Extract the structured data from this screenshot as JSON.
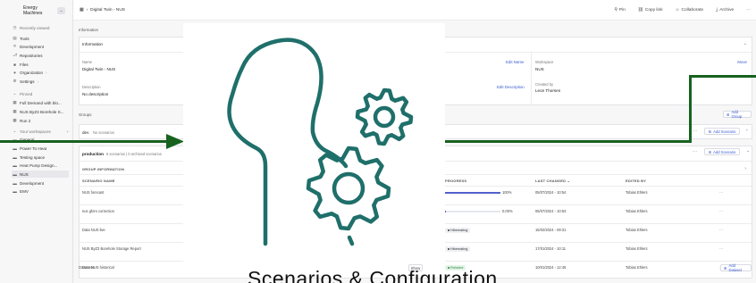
{
  "org": {
    "name": "Energy Machines",
    "switch_icon": "chevron-updown-icon"
  },
  "sidebar": {
    "recent": "Recently viewed",
    "nav": [
      {
        "label": "Tools",
        "icon": "tools-icon"
      },
      {
        "label": "Development",
        "icon": "development-icon"
      },
      {
        "label": "Repositories",
        "icon": "repositories-icon"
      },
      {
        "label": "Files",
        "icon": "files-icon"
      },
      {
        "label": "Organization",
        "icon": "organization-icon"
      },
      {
        "label": "Settings",
        "icon": "settings-icon"
      }
    ],
    "pinned_title": "Pinned",
    "pinned": [
      {
        "label": "Full Demand with blo..."
      },
      {
        "label": "NUS ByZ3 Borehole S..."
      },
      {
        "label": "Run 2"
      }
    ],
    "workspaces_title": "Your workspaces",
    "workspaces": [
      {
        "label": "General"
      },
      {
        "label": "Power To Heat"
      },
      {
        "label": "Testing space"
      },
      {
        "label": "Heat Pump Design..."
      },
      {
        "label": "NUS"
      },
      {
        "label": "Development"
      },
      {
        "label": "EMV"
      }
    ]
  },
  "topbar": {
    "breadcrumb": "Digital Twin - NUS",
    "actions": [
      {
        "label": "Pin"
      },
      {
        "label": "Copy link"
      },
      {
        "label": "Collaborate"
      },
      {
        "label": "Archive"
      }
    ]
  },
  "information": {
    "section": "Information",
    "panel_title": "Information",
    "name_label": "Name",
    "name_value": "Digital Twin - NUS",
    "edit_name": "Edit Name",
    "desc_label": "Description",
    "desc_value": "No description",
    "edit_desc": "Edit Description",
    "workspace_label": "Workspace",
    "workspace_value": "NUS",
    "move": "Move",
    "created_label": "Created by",
    "created_value": "Leon Thorsen"
  },
  "groups": {
    "section": "Groups",
    "add_group": "Add Group",
    "dev": {
      "name": "dev",
      "note": "No scenarios",
      "add": "Add Scenario"
    },
    "production": {
      "name": "production",
      "meta": "5 scenarios | 0 archived scenarios",
      "add": "Add Scenario",
      "group_info": "GROUP INFORMATION",
      "headers": {
        "name": "SCENARIO NAME",
        "progress": "PROGRESS",
        "changed": "LAST CHANGED",
        "edited": "EDITED BY"
      },
      "rows": [
        {
          "name": "NUS forecast",
          "progress": 100,
          "progress_label": "100%",
          "status": "",
          "changed": "05/07/2024 - 10:54",
          "edited": "Tobias Ehlers"
        },
        {
          "name": "nus gfors correction",
          "progress": 0,
          "progress_label": "0.00%",
          "status": "",
          "changed": "05/07/2024 - 10:53",
          "edited": "Tobias Ehlers"
        },
        {
          "name": "Data NUS live",
          "progress": null,
          "progress_label": "",
          "status": "Hibernating",
          "changed": "15/02/2024 - 09:31",
          "edited": "Tobias Ehlers"
        },
        {
          "name": "NUS ByZ3 Borehole Storage Report",
          "progress": null,
          "progress_label": "",
          "status": "Hibernating",
          "changed": "17/01/2024 - 10:11",
          "edited": "Tobias Ehlers"
        },
        {
          "name": "Data NUS historical",
          "progress": null,
          "progress_label": "",
          "status": "Finished",
          "changed": "10/01/2024 - 12:45",
          "edited": "Tobias Ehlers"
        }
      ]
    }
  },
  "datasets": {
    "section": "Datasets",
    "show": "Show",
    "add": "Add Dataset"
  },
  "overlay": {
    "title": "Scenarios & Configuration",
    "icon": "person-with-gears-icon"
  },
  "colors": {
    "accent": "#3b5bcf",
    "progress": "#5361cc",
    "connector": "#17621f",
    "icon_teal": "#1f6f6a"
  }
}
